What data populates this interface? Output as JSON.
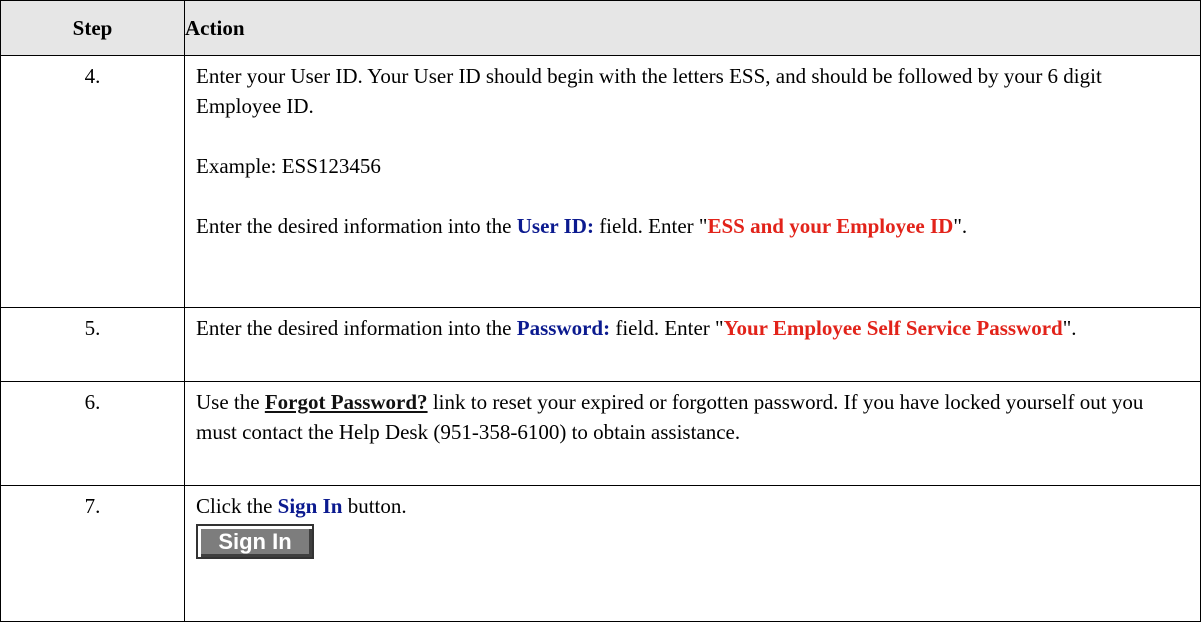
{
  "header": {
    "step": "Step",
    "action": "Action"
  },
  "rows": [
    {
      "num": "4.",
      "text1": "Enter your User ID. Your User ID should begin with the letters ESS, and should be followed by your 6 digit Employee ID.",
      "example": "Example:  ESS123456",
      "instr_pre": "Enter the desired information into the ",
      "field": "User ID:",
      "instr_mid": " field. Enter \"",
      "value": "ESS and your Employee ID",
      "instr_end": "\"."
    },
    {
      "num": "5.",
      "instr_pre": "Enter the desired information into the ",
      "field": "Password:",
      "instr_mid": " field. Enter \"",
      "value": "Your Employee Self Service Password",
      "instr_end": "\"."
    },
    {
      "num": "6.",
      "pre": "Use the ",
      "link": "Forgot Password?",
      "post": " link to reset your expired or forgotten password.  If you have locked yourself out you must contact the Help Desk (951-358-6100) to obtain assistance."
    },
    {
      "num": "7.",
      "pre": "Click the ",
      "button_ref": "Sign In",
      "post": " button.",
      "button_label": "Sign In"
    }
  ]
}
